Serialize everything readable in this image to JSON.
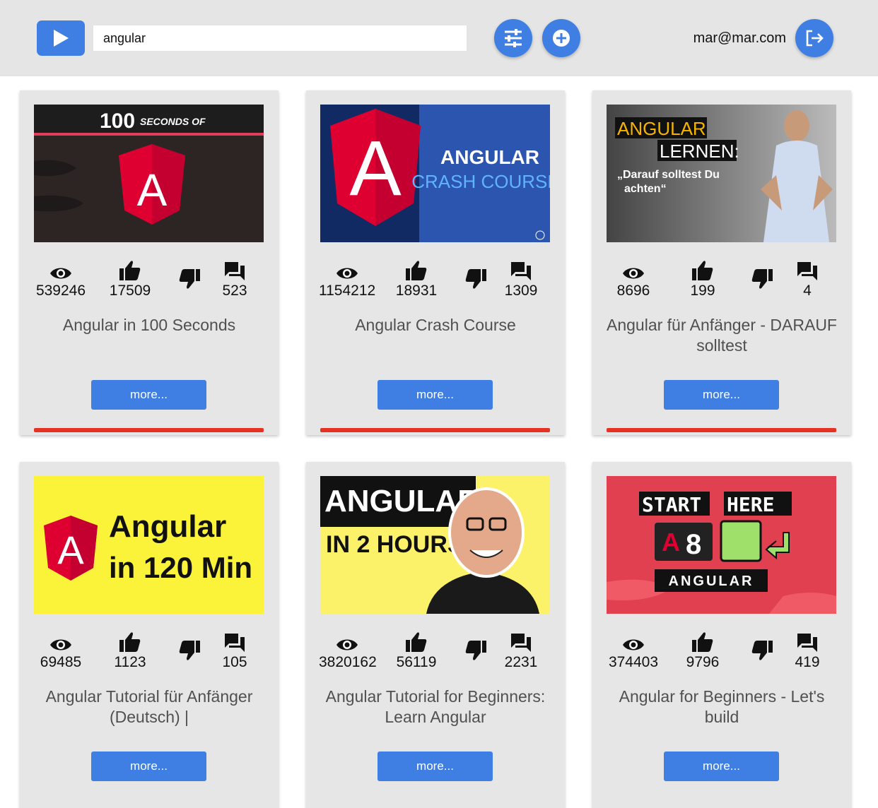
{
  "header": {
    "logo_icon": "play-icon",
    "search_value": "angular",
    "filter_icon": "tune-icon",
    "add_icon": "plus-circle-icon",
    "user_email": "mar@mar.com",
    "logout_icon": "logout-icon",
    "accent_color": "#3f7fe3"
  },
  "videos": [
    {
      "views": "539246",
      "likes": "17509",
      "comments": "523",
      "title": "Angular in 100 Seconds",
      "more_label": "more...",
      "thumb": {
        "line1": "100",
        "line2": "SECONDS OF"
      }
    },
    {
      "views": "1154212",
      "likes": "18931",
      "comments": "1309",
      "title": "Angular Crash Course",
      "more_label": "more...",
      "thumb": {
        "line1": "ANGULAR",
        "line2": "CRASH COURSE"
      }
    },
    {
      "views": "8696",
      "likes": "199",
      "comments": "4",
      "title": "Angular für Anfänger - DARAUF solltest",
      "more_label": "more...",
      "thumb": {
        "line1": "ANGULAR",
        "line2": "LERNEN:",
        "line3": "„Darauf solltest Du",
        "line4": "achten“"
      }
    },
    {
      "views": "69485",
      "likes": "1123",
      "comments": "105",
      "title": "Angular Tutorial für Anfänger (Deutsch) |",
      "more_label": "more...",
      "thumb": {
        "line1": "Angular",
        "line2": "in 120 Min"
      }
    },
    {
      "views": "3820162",
      "likes": "56119",
      "comments": "2231",
      "title": "Angular Tutorial for Beginners: Learn Angular",
      "more_label": "more...",
      "thumb": {
        "line1": "ANGULAR",
        "line2": "IN 2 HOURS"
      }
    },
    {
      "views": "374403",
      "likes": "9796",
      "comments": "419",
      "title": "Angular for Beginners - Let's build",
      "more_label": "more...",
      "thumb": {
        "line1": "START",
        "line2": "HERE",
        "line3": "A",
        "line4": "8",
        "line5": "ANGULAR"
      }
    }
  ],
  "stat_icons": {
    "views": "eye-icon",
    "likes": "thumb-up-icon",
    "dislikes": "thumb-down-icon",
    "comments": "comment-icon"
  }
}
